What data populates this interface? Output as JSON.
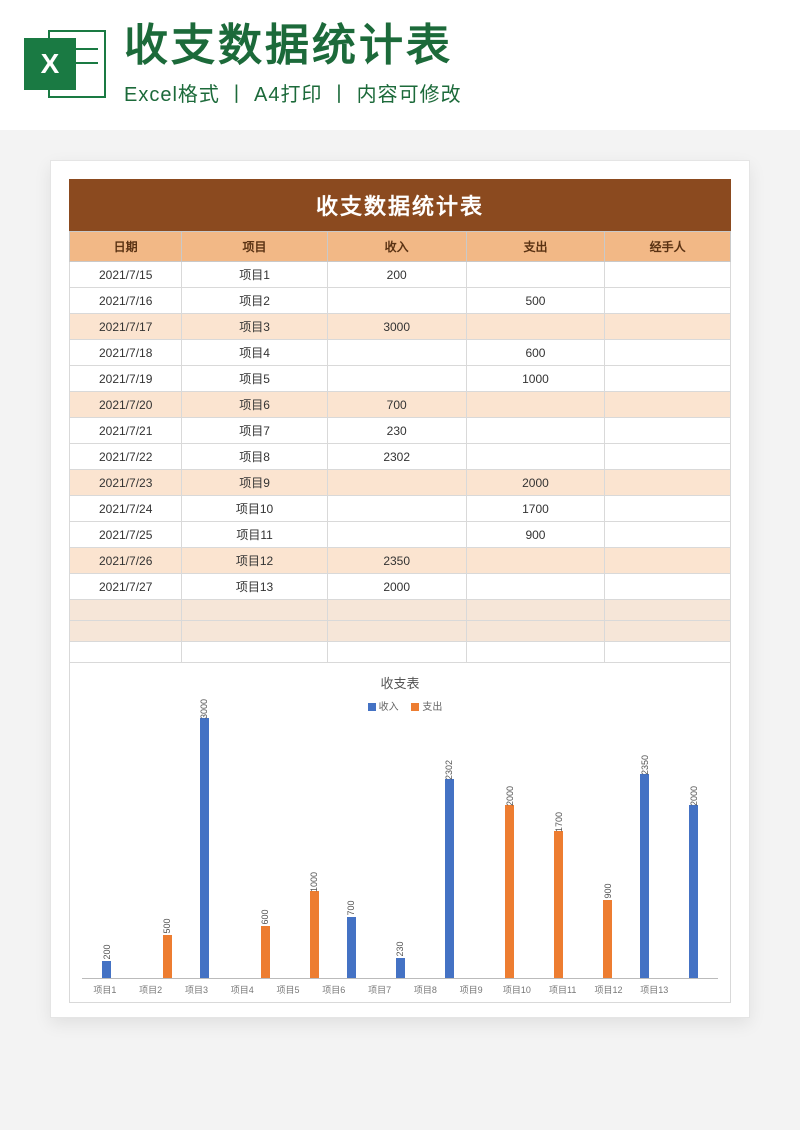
{
  "header": {
    "excel_letter": "X",
    "big_title": "收支数据统计表",
    "sub_title": "Excel格式 丨 A4打印 丨 内容可修改"
  },
  "document": {
    "title": "收支数据统计表",
    "columns": {
      "date": "日期",
      "item": "项目",
      "income": "收入",
      "expense": "支出",
      "handler": "经手人"
    }
  },
  "rows": [
    {
      "date": "2021/7/15",
      "item": "项目1",
      "income": "200",
      "expense": "",
      "band": false
    },
    {
      "date": "2021/7/16",
      "item": "项目2",
      "income": "",
      "expense": "500",
      "band": false
    },
    {
      "date": "2021/7/17",
      "item": "项目3",
      "income": "3000",
      "expense": "",
      "band": true
    },
    {
      "date": "2021/7/18",
      "item": "项目4",
      "income": "",
      "expense": "600",
      "band": false
    },
    {
      "date": "2021/7/19",
      "item": "项目5",
      "income": "",
      "expense": "1000",
      "band": false
    },
    {
      "date": "2021/7/20",
      "item": "项目6",
      "income": "700",
      "expense": "",
      "band": true
    },
    {
      "date": "2021/7/21",
      "item": "项目7",
      "income": "230",
      "expense": "",
      "band": false
    },
    {
      "date": "2021/7/22",
      "item": "项目8",
      "income": "2302",
      "expense": "",
      "band": false
    },
    {
      "date": "2021/7/23",
      "item": "项目9",
      "income": "",
      "expense": "2000",
      "band": true
    },
    {
      "date": "2021/7/24",
      "item": "项目10",
      "income": "",
      "expense": "1700",
      "band": false
    },
    {
      "date": "2021/7/25",
      "item": "项目11",
      "income": "",
      "expense": "900",
      "band": false
    },
    {
      "date": "2021/7/26",
      "item": "项目12",
      "income": "2350",
      "expense": "",
      "band": true
    },
    {
      "date": "2021/7/27",
      "item": "项目13",
      "income": "2000",
      "expense": "",
      "band": false
    }
  ],
  "chart": {
    "title": "收支表",
    "legend_in": "收入",
    "legend_out": "支出"
  },
  "chart_data": {
    "type": "bar",
    "title": "收支表",
    "xlabel": "",
    "ylabel": "",
    "ylim": [
      0,
      3000
    ],
    "categories": [
      "项目1",
      "项目2",
      "项目3",
      "项目4",
      "项目5",
      "项目6",
      "项目7",
      "项目8",
      "项目9",
      "项目10",
      "项目11",
      "项目12",
      "项目13"
    ],
    "series": [
      {
        "name": "收入",
        "color": "#4472c4",
        "values": [
          200,
          null,
          3000,
          null,
          null,
          700,
          230,
          2302,
          null,
          null,
          null,
          2350,
          2000
        ]
      },
      {
        "name": "支出",
        "color": "#ed7d31",
        "values": [
          null,
          500,
          null,
          600,
          1000,
          null,
          null,
          null,
          2000,
          1700,
          900,
          null,
          null
        ]
      }
    ]
  }
}
